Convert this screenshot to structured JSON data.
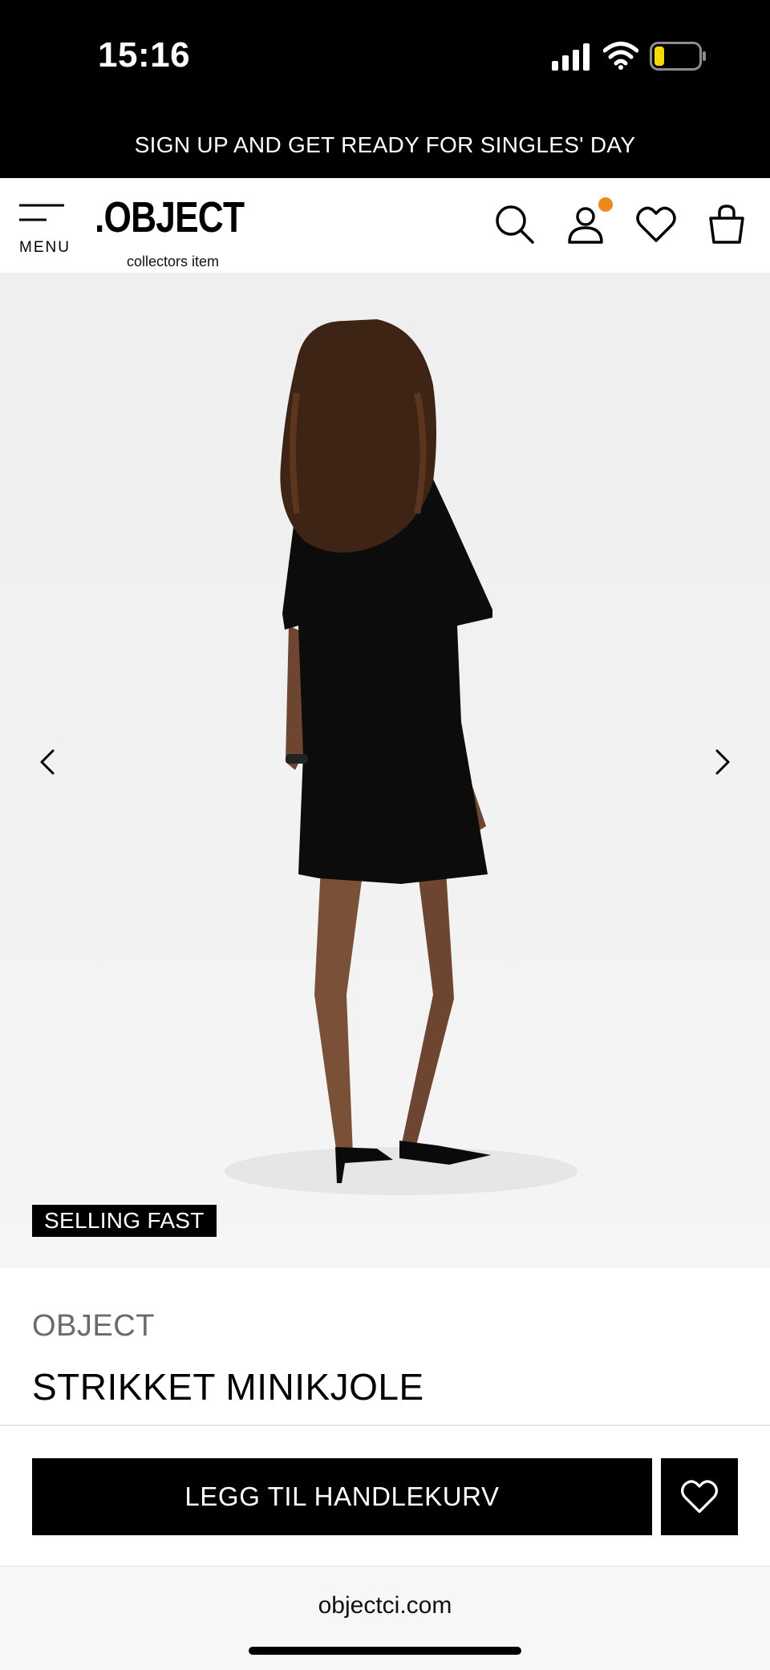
{
  "status_bar": {
    "time": "15:16",
    "icons": [
      "signal-icon",
      "wifi-icon",
      "battery-icon"
    ],
    "battery_color": "#f5d90a"
  },
  "promo_banner": {
    "text": "SIGN UP AND GET READY FOR SINGLES' DAY"
  },
  "header": {
    "menu_label": "MENU",
    "logo_main": ".OBJECT",
    "logo_sub": "collectors item",
    "icons": [
      "search-icon",
      "account-icon",
      "wishlist-icon",
      "bag-icon"
    ],
    "notification_dot_color": "#ee8a1c"
  },
  "gallery": {
    "prev_icon": "chevron-left-icon",
    "next_icon": "chevron-right-icon",
    "badge": "SELLING FAST"
  },
  "product": {
    "brand": "OBJECT",
    "name": "STRIKKET MINIKJOLE"
  },
  "actions": {
    "add_to_cart": "LEGG TIL HANDLEKURV",
    "wishlist_icon": "heart-icon"
  },
  "browser": {
    "url": "objectci.com"
  }
}
